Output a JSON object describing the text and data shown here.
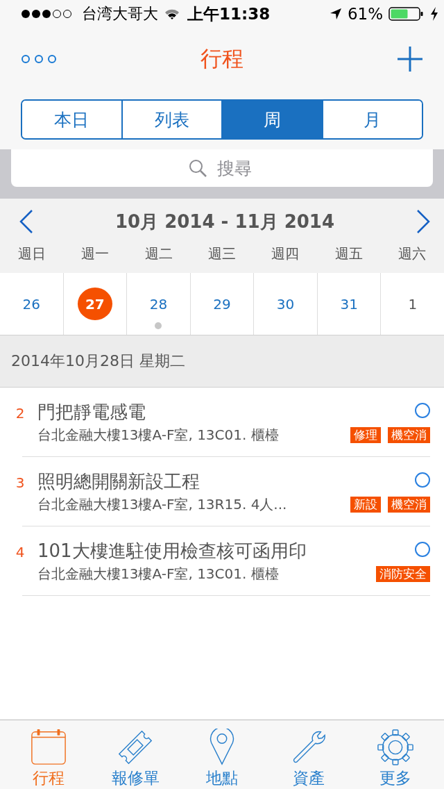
{
  "status_bar": {
    "carrier": "台湾大哥大",
    "time": "上午11:38",
    "battery": "61%"
  },
  "nav": {
    "title": "行程"
  },
  "segments": [
    {
      "label": "本日",
      "selected": false
    },
    {
      "label": "列表",
      "selected": false
    },
    {
      "label": "周",
      "selected": true
    },
    {
      "label": "月",
      "selected": false
    }
  ],
  "search": {
    "placeholder": "搜尋"
  },
  "calendar": {
    "range": "10月 2014 - 11月 2014",
    "weekdays": [
      "週日",
      "週一",
      "週二",
      "週三",
      "週四",
      "週五",
      "週六"
    ],
    "days": [
      {
        "label": "26",
        "today": false,
        "has_events": false,
        "other_month": false
      },
      {
        "label": "27",
        "today": true,
        "has_events": false,
        "other_month": false
      },
      {
        "label": "28",
        "today": false,
        "has_events": true,
        "other_month": false
      },
      {
        "label": "29",
        "today": false,
        "has_events": false,
        "other_month": false
      },
      {
        "label": "30",
        "today": false,
        "has_events": false,
        "other_month": false
      },
      {
        "label": "31",
        "today": false,
        "has_events": false,
        "other_month": false
      },
      {
        "label": "1",
        "today": false,
        "has_events": false,
        "other_month": true
      }
    ]
  },
  "date_header": "2014年10月28日 星期二",
  "events": [
    {
      "number": "2",
      "title": "門把靜電感電",
      "location": "台北金融大樓13樓A-F室, 13C01. 櫃檯",
      "tags": [
        "修理",
        "機空消"
      ],
      "checked": false
    },
    {
      "number": "3",
      "title": "照明總開關新設工程",
      "location": "台北金融大樓13樓A-F室, 13R15. 4人...",
      "tags": [
        "新設",
        "機空消"
      ],
      "checked": false
    },
    {
      "number": "4",
      "title": "101大樓進駐使用檢查核可函用印",
      "location": "台北金融大樓13樓A-F室, 13C01. 櫃檯",
      "tags": [
        "消防安全"
      ],
      "checked": false
    }
  ],
  "tab_bar": [
    {
      "kind": "calendar",
      "label": "行程",
      "selected": true
    },
    {
      "kind": "ticket",
      "label": "報修單",
      "selected": false
    },
    {
      "kind": "pin",
      "label": "地點",
      "selected": false
    },
    {
      "kind": "wrench",
      "label": "資產",
      "selected": false
    },
    {
      "kind": "gear",
      "label": "更多",
      "selected": false
    }
  ]
}
